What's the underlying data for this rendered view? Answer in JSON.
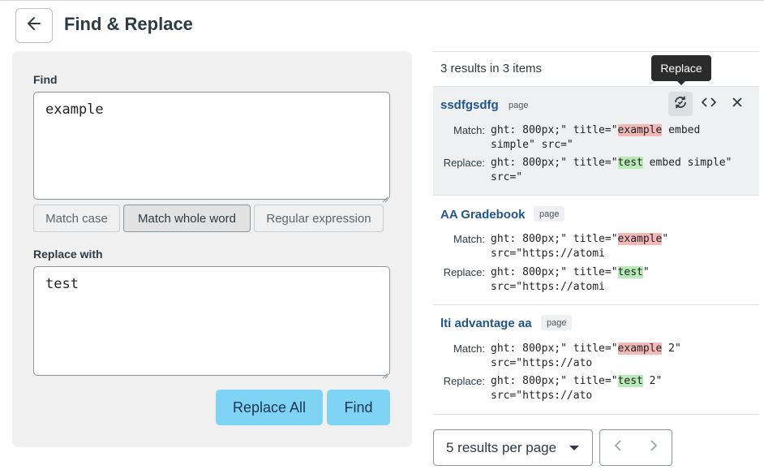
{
  "header": {
    "title": "Find & Replace"
  },
  "find": {
    "label": "Find",
    "value": "example"
  },
  "options": [
    {
      "label": "Match case",
      "active": false
    },
    {
      "label": "Match whole word",
      "active": true
    },
    {
      "label": "Regular expression",
      "active": false
    }
  ],
  "replace": {
    "label": "Replace with",
    "value": "test"
  },
  "actions": {
    "replace_all": "Replace All",
    "find": "Find"
  },
  "results": {
    "summary": "3 results in 3 items",
    "tooltip": "Replace",
    "match_label": "Match:",
    "replace_label": "Replace:",
    "items": [
      {
        "title": "ssdfgsdfg",
        "badge": "page",
        "match": {
          "pre": "ght: 800px;\" title=\"",
          "hit": "example",
          "post": " embed simple\" src=\""
        },
        "replace": {
          "pre": "ght: 800px;\" title=\"",
          "hit": "test",
          "post": " embed simple\" src=\""
        }
      },
      {
        "title": "AA Gradebook",
        "badge": "page",
        "match": {
          "pre": "ght: 800px;\" title=\"",
          "hit": "example",
          "post": "\" src=\"https://atomi"
        },
        "replace": {
          "pre": "ght: 800px;\" title=\"",
          "hit": "test",
          "post": "\" src=\"https://atomi"
        }
      },
      {
        "title": "lti advantage aa",
        "badge": "page",
        "match": {
          "pre": "ght: 800px;\" title=\"",
          "hit": "example",
          "post": " 2\" src=\"https://ato"
        },
        "replace": {
          "pre": "ght: 800px;\" title=\"",
          "hit": "test",
          "post": " 2\" src=\"https://ato"
        }
      }
    ]
  },
  "pagination": {
    "per_page": "5 results per page"
  },
  "colors": {
    "accent": "#7fd3f5",
    "link": "#22568a",
    "match_highlight": "#f3b8b8",
    "replace_highlight": "#b8ebb7"
  }
}
